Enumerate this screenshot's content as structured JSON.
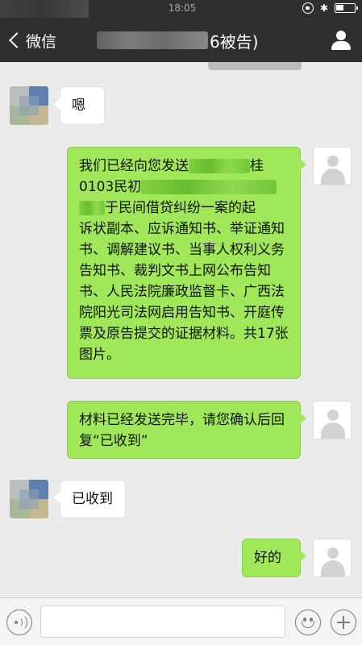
{
  "status_bar": {
    "time": "18:05",
    "bluetooth_glyph": "✱",
    "battery_level": 0.45
  },
  "nav": {
    "back_label": "微信",
    "title_suffix": "6被告)",
    "icons": {
      "back": "chevron-left-icon",
      "profile": "person-icon"
    }
  },
  "messages": [
    {
      "side": "left",
      "text": "嗯"
    },
    {
      "side": "right",
      "line1_a": "我们已经向您发送",
      "line1_b": "桂",
      "line2_a": "0103民初",
      "line3_b": "于民间借贷纠纷一案的起",
      "rest": "诉状副本、应诉通知书、举证通知书、调解建议书、当事人权利义务告知书、裁判文书上网公布告知书、人民法院廉政监督卡、广西法院阳光司法网启用告知书、开庭传票及原告提交的证据材料。共17张图片。"
    },
    {
      "side": "right",
      "text": "材料已经发送完毕，请您确认后回复“已收到”"
    },
    {
      "side": "left",
      "text": "已收到"
    },
    {
      "side": "right",
      "text": "好的"
    }
  ],
  "input_bar": {
    "voice_icon": "voice-icon",
    "emoji_icon": "emoji-icon",
    "plus_icon": "plus-icon",
    "input_value": ""
  },
  "colors": {
    "nav_bg": "#2f2f2f",
    "chat_bg": "#ebebeb",
    "bubble_right": "#a0e75a",
    "bubble_left": "#ffffff"
  }
}
